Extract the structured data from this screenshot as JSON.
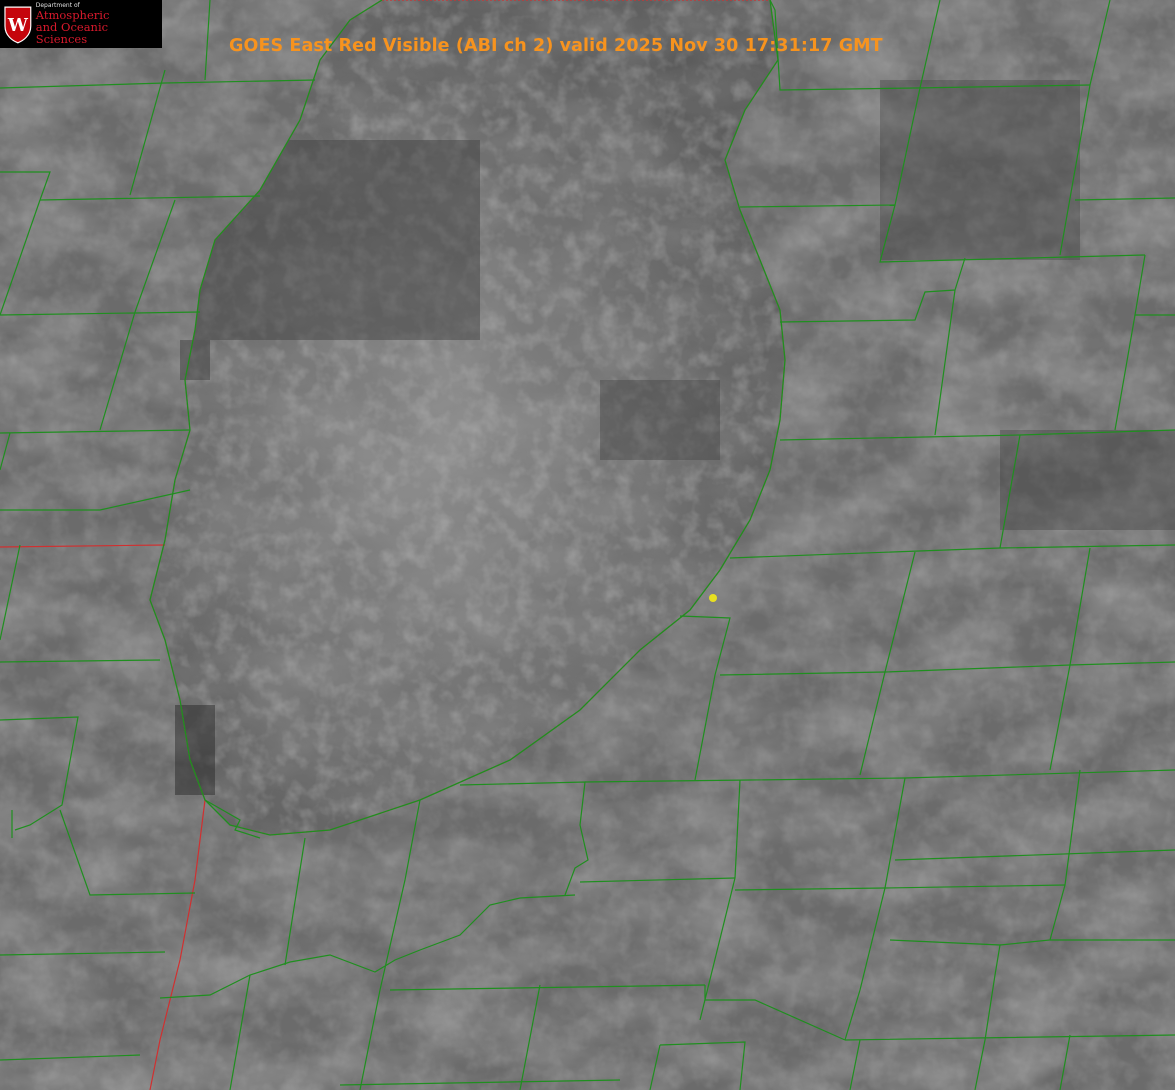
{
  "image": {
    "title": "GOES East Red Visible (ABI ch 2) valid 2025 Nov 30 17:31:17 GMT",
    "logo": {
      "department": "Department of",
      "line1": "Atmospheric",
      "line2": "and Oceanic Sciences",
      "crest_letter": "W",
      "colors": {
        "crest": "#c5050c",
        "text": "#d8192c",
        "background": "#000000"
      }
    },
    "colors": {
      "title": "#f7931e",
      "county_lines": "#1f8f1f",
      "state_lines": "#d03030",
      "marker": "#e8e020",
      "land_base": "#6a6a6a",
      "lake_base": "#5e5e5e"
    },
    "marker_icon": "yellow-dot-marker"
  }
}
